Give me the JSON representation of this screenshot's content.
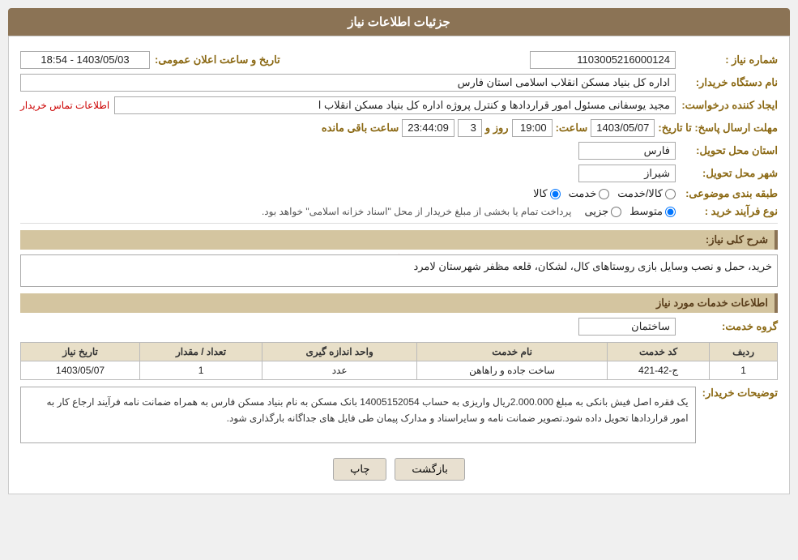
{
  "header": {
    "title": "جزئیات اطلاعات نیاز"
  },
  "fields": {
    "need_number_label": "شماره نیاز :",
    "need_number_value": "1103005216000124",
    "org_name_label": "نام دستگاه خریدار:",
    "org_name_value": "اداره کل بنیاد مسکن انقلاب اسلامی استان فارس",
    "creator_label": "ایجاد کننده درخواست:",
    "creator_value": "مجید یوسفانی مسئول امور قراردادها و کنترل پروژه اداره کل بنیاد مسکن انقلاب ا",
    "creator_link": "اطلاعات تماس خریدار",
    "deadline_label": "مهلت ارسال پاسخ: تا تاریخ:",
    "deadline_date": "1403/05/07",
    "deadline_time_label": "ساعت:",
    "deadline_time": "19:00",
    "deadline_days_label": "روز و",
    "deadline_days": "3",
    "deadline_remaining_label": "ساعت باقی مانده",
    "deadline_remaining": "23:44:09",
    "province_label": "استان محل تحویل:",
    "province_value": "فارس",
    "city_label": "شهر محل تحویل:",
    "city_value": "شیراز",
    "category_label": "طبقه بندی موضوعی:",
    "category_options": [
      "کالا",
      "خدمت",
      "کالا/خدمت"
    ],
    "category_selected": "کالا",
    "process_label": "نوع فرآیند خرید :",
    "process_options": [
      "جزیی",
      "متوسط"
    ],
    "process_selected": "متوسط",
    "process_desc": "پرداخت تمام یا بخشی از مبلغ خریدار از محل \"اسناد خزانه اسلامی\" خواهد بود.",
    "need_summary_label": "شرح کلی نیاز:",
    "need_summary_value": "خرید، حمل و نصب وسایل بازی روستاهای کال، لشکان، قلعه مظفر شهرستان لامرد",
    "services_section_label": "اطلاعات خدمات مورد نیاز",
    "service_group_label": "گروه خدمت:",
    "service_group_value": "ساختمان",
    "announce_datetime_label": "تاریخ و ساعت اعلان عمومی:",
    "announce_datetime_value": "1403/05/03 - 18:54"
  },
  "table": {
    "headers": [
      "ردیف",
      "کد خدمت",
      "نام خدمت",
      "واحد اندازه گیری",
      "تعداد / مقدار",
      "تاریخ نیاز"
    ],
    "rows": [
      {
        "row": "1",
        "code": "ج-42-421",
        "name": "ساخت جاده و راهاهن",
        "unit": "عدد",
        "qty": "1",
        "date": "1403/05/07"
      }
    ]
  },
  "notes": {
    "label": "توضیحات خریدار:",
    "text": "یک فقره اصل فیش بانکی به مبلغ 2.000.000ریال واریزی به حساب 14005152054 بانک مسکن به نام بنیاد مسکن فارس به همراه ضمانت نامه فرآیند ارجاع کار به امور قراردادها تحویل داده شود.تصویر ضمانت نامه و سایراسناد و مدارک پیمان طی فایل های جداگانه بارگذاری شود."
  },
  "buttons": {
    "print": "چاپ",
    "back": "بازگشت"
  }
}
